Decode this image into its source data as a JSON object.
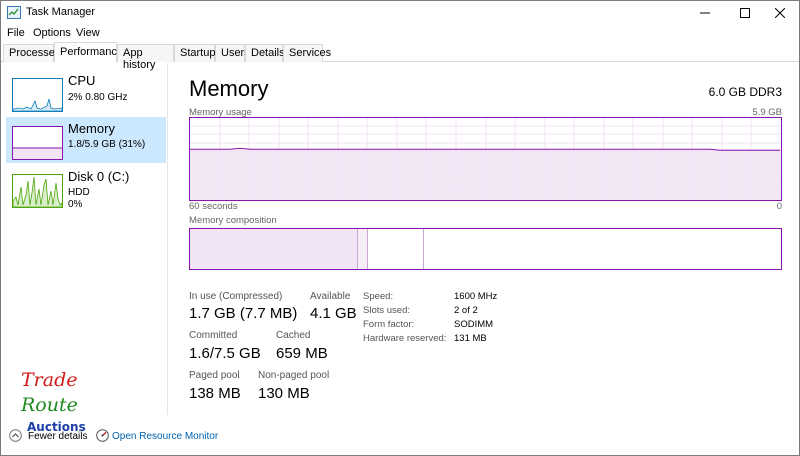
{
  "window": {
    "title": "Task Manager"
  },
  "menu": [
    "File",
    "Options",
    "View"
  ],
  "tabs": [
    "Processes",
    "Performance",
    "App history",
    "Startup",
    "Users",
    "Details",
    "Services"
  ],
  "active_tab": "Performance",
  "sidebar": {
    "items": [
      {
        "title": "CPU",
        "line1": "2%  0.80 GHz",
        "line2": "",
        "color": "#117dbb"
      },
      {
        "title": "Memory",
        "line1": "1.8/5.9 GB (31%)",
        "line2": "",
        "color": "#8b12ae"
      },
      {
        "title": "Disk 0 (C:)",
        "line1": "HDD",
        "line2": "0%",
        "color": "#4da60c"
      }
    ]
  },
  "main": {
    "title": "Memory",
    "spec": "6.0 GB DDR3",
    "usage_label": "Memory usage",
    "usage_max": "5.9 GB",
    "time_left": "60 seconds",
    "time_right": "0",
    "composition_label": "Memory composition",
    "usage_level": 0.31,
    "stats": {
      "in_use_label": "In use (Compressed)",
      "in_use_value": "1.7 GB (7.7 MB)",
      "available_label": "Available",
      "available_value": "4.1 GB",
      "committed_label": "Committed",
      "committed_value": "1.6/7.5 GB",
      "cached_label": "Cached",
      "cached_value": "659 MB",
      "paged_label": "Paged pool",
      "paged_value": "138 MB",
      "nonpaged_label": "Non-paged pool",
      "nonpaged_value": "130 MB"
    },
    "details": [
      {
        "label": "Speed:",
        "value": "1600 MHz"
      },
      {
        "label": "Slots used:",
        "value": "2 of 2"
      },
      {
        "label": "Form factor:",
        "value": "SODIMM"
      },
      {
        "label": "Hardware reserved:",
        "value": "131 MB"
      }
    ]
  },
  "footer": {
    "fewer_details": "Fewer details",
    "resource_monitor": "Open Resource Monitor"
  },
  "colors": {
    "memory": "#8b12ae",
    "cpu": "#117dbb",
    "disk": "#4da60c",
    "selected": "#cce8ff",
    "link": "#0063b1"
  },
  "logo_text": [
    "Trade",
    "Route",
    "Auctions"
  ]
}
